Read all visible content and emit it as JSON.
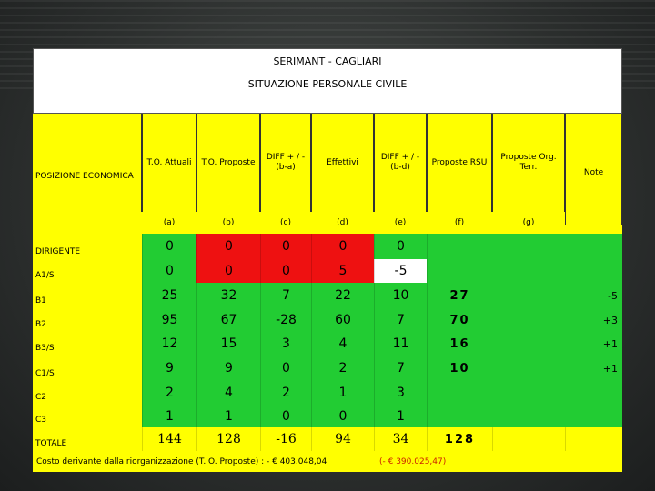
{
  "title": "SERIMANT - CAGLIARI",
  "subtitle": "SITUAZIONE PERSONALE CIVILE",
  "headers": [
    {
      "name": "posizione",
      "label": "POSIZIONE ECONOMICA",
      "letter": ""
    },
    {
      "name": "to-attuali",
      "label": "T.O. Attuali",
      "letter": "(a)"
    },
    {
      "name": "to-proposte",
      "label": "T.O. Proposte",
      "letter": "(b)"
    },
    {
      "name": "diff-ba",
      "label": "DIFF + / - (b-a)",
      "letter": "(c)"
    },
    {
      "name": "effettivi",
      "label": "Effettivi",
      "letter": "(d)"
    },
    {
      "name": "diff-bd",
      "label": "DIFF + / - (b-d)",
      "letter": "(e)"
    },
    {
      "name": "proposte-rsu",
      "label": "Proposte RSU",
      "letter": "(f)"
    },
    {
      "name": "proposte-org",
      "label": "Proposte Org. Terr.",
      "letter": "(g)"
    },
    {
      "name": "note",
      "label": "Note",
      "letter": ""
    }
  ],
  "rows": [
    {
      "label": "DIRIGENTE",
      "a": "0",
      "b": "0",
      "c": "0",
      "d": "0",
      "e": "0",
      "f": "",
      "g": "",
      "note": ""
    },
    {
      "label": "A1/S",
      "a": "0",
      "b": "0",
      "c": "0",
      "d": "5",
      "e": "-5",
      "f": "",
      "g": "",
      "note": ""
    },
    {
      "label": "B1",
      "a": "25",
      "b": "32",
      "c": "7",
      "d": "22",
      "e": "10",
      "f": "27",
      "g": "",
      "note": "-5"
    },
    {
      "label": "B2",
      "a": "95",
      "b": "67",
      "c": "-28",
      "d": "60",
      "e": "7",
      "f": "70",
      "g": "",
      "note": "+3"
    },
    {
      "label": "B3/S",
      "a": "12",
      "b": "15",
      "c": "3",
      "d": "4",
      "e": "11",
      "f": "16",
      "g": "",
      "note": "+1"
    },
    {
      "label": "C1/S",
      "a": "9",
      "b": "9",
      "c": "0",
      "d": "2",
      "e": "7",
      "f": "10",
      "g": "",
      "note": "+1"
    },
    {
      "label": "C2",
      "a": "2",
      "b": "4",
      "c": "2",
      "d": "1",
      "e": "3",
      "f": "",
      "g": "",
      "note": ""
    },
    {
      "label": "C3",
      "a": "1",
      "b": "1",
      "c": "0",
      "d": "0",
      "e": "1",
      "f": "",
      "g": "",
      "note": ""
    },
    {
      "label": "TOTALE",
      "a": "144",
      "b": "128",
      "c": "-16",
      "d": "94",
      "e": "34",
      "f": "128",
      "g": "",
      "note": ""
    }
  ],
  "footer": {
    "cost_text": "Costo derivante dalla riorganizzazione (T. O. Proposte) : - € 403.048,04",
    "cost_alt": "(- € 390.025,47)"
  },
  "colors": {
    "green": "#22cc33",
    "red": "#ee1111",
    "yellow": "#ffff00",
    "white": "#ffffff"
  }
}
